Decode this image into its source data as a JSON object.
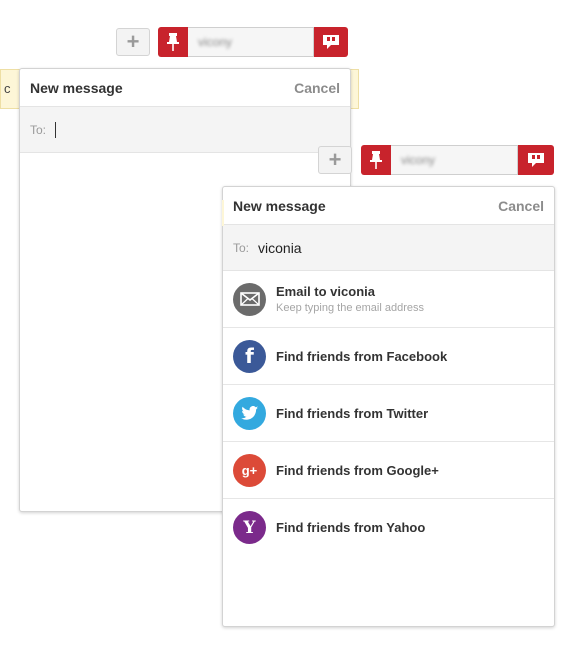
{
  "toolbar": {
    "add_symbol": "+",
    "username": "vicony"
  },
  "notice": {
    "leading_char": "c"
  },
  "panel1": {
    "title": "New message",
    "cancel": "Cancel",
    "to_label": "To:",
    "to_value": ""
  },
  "panel2": {
    "title": "New message",
    "cancel": "Cancel",
    "to_label": "To:",
    "to_value": "viconia",
    "suggestions": [
      {
        "label": "Email to viconia",
        "sub": "Keep typing the email address",
        "icon": "envelope-icon",
        "color": "#6b6b6b"
      },
      {
        "label": "Find friends from Facebook",
        "sub": "",
        "icon": "facebook-icon",
        "color": "#3b5998"
      },
      {
        "label": "Find friends from Twitter",
        "sub": "",
        "icon": "twitter-icon",
        "color": "#33a9df"
      },
      {
        "label": "Find friends from Google+",
        "sub": "",
        "icon": "google-plus-icon",
        "color": "#dc4a38"
      },
      {
        "label": "Find friends from Yahoo",
        "sub": "",
        "icon": "yahoo-icon",
        "color": "#7b2a8b"
      }
    ],
    "glyphs": {
      "facebook": "f",
      "google_plus": "g+",
      "yahoo": "Y"
    }
  },
  "colors": {
    "brand_red": "#c8232c",
    "notice_bg": "#fdf6d7"
  }
}
